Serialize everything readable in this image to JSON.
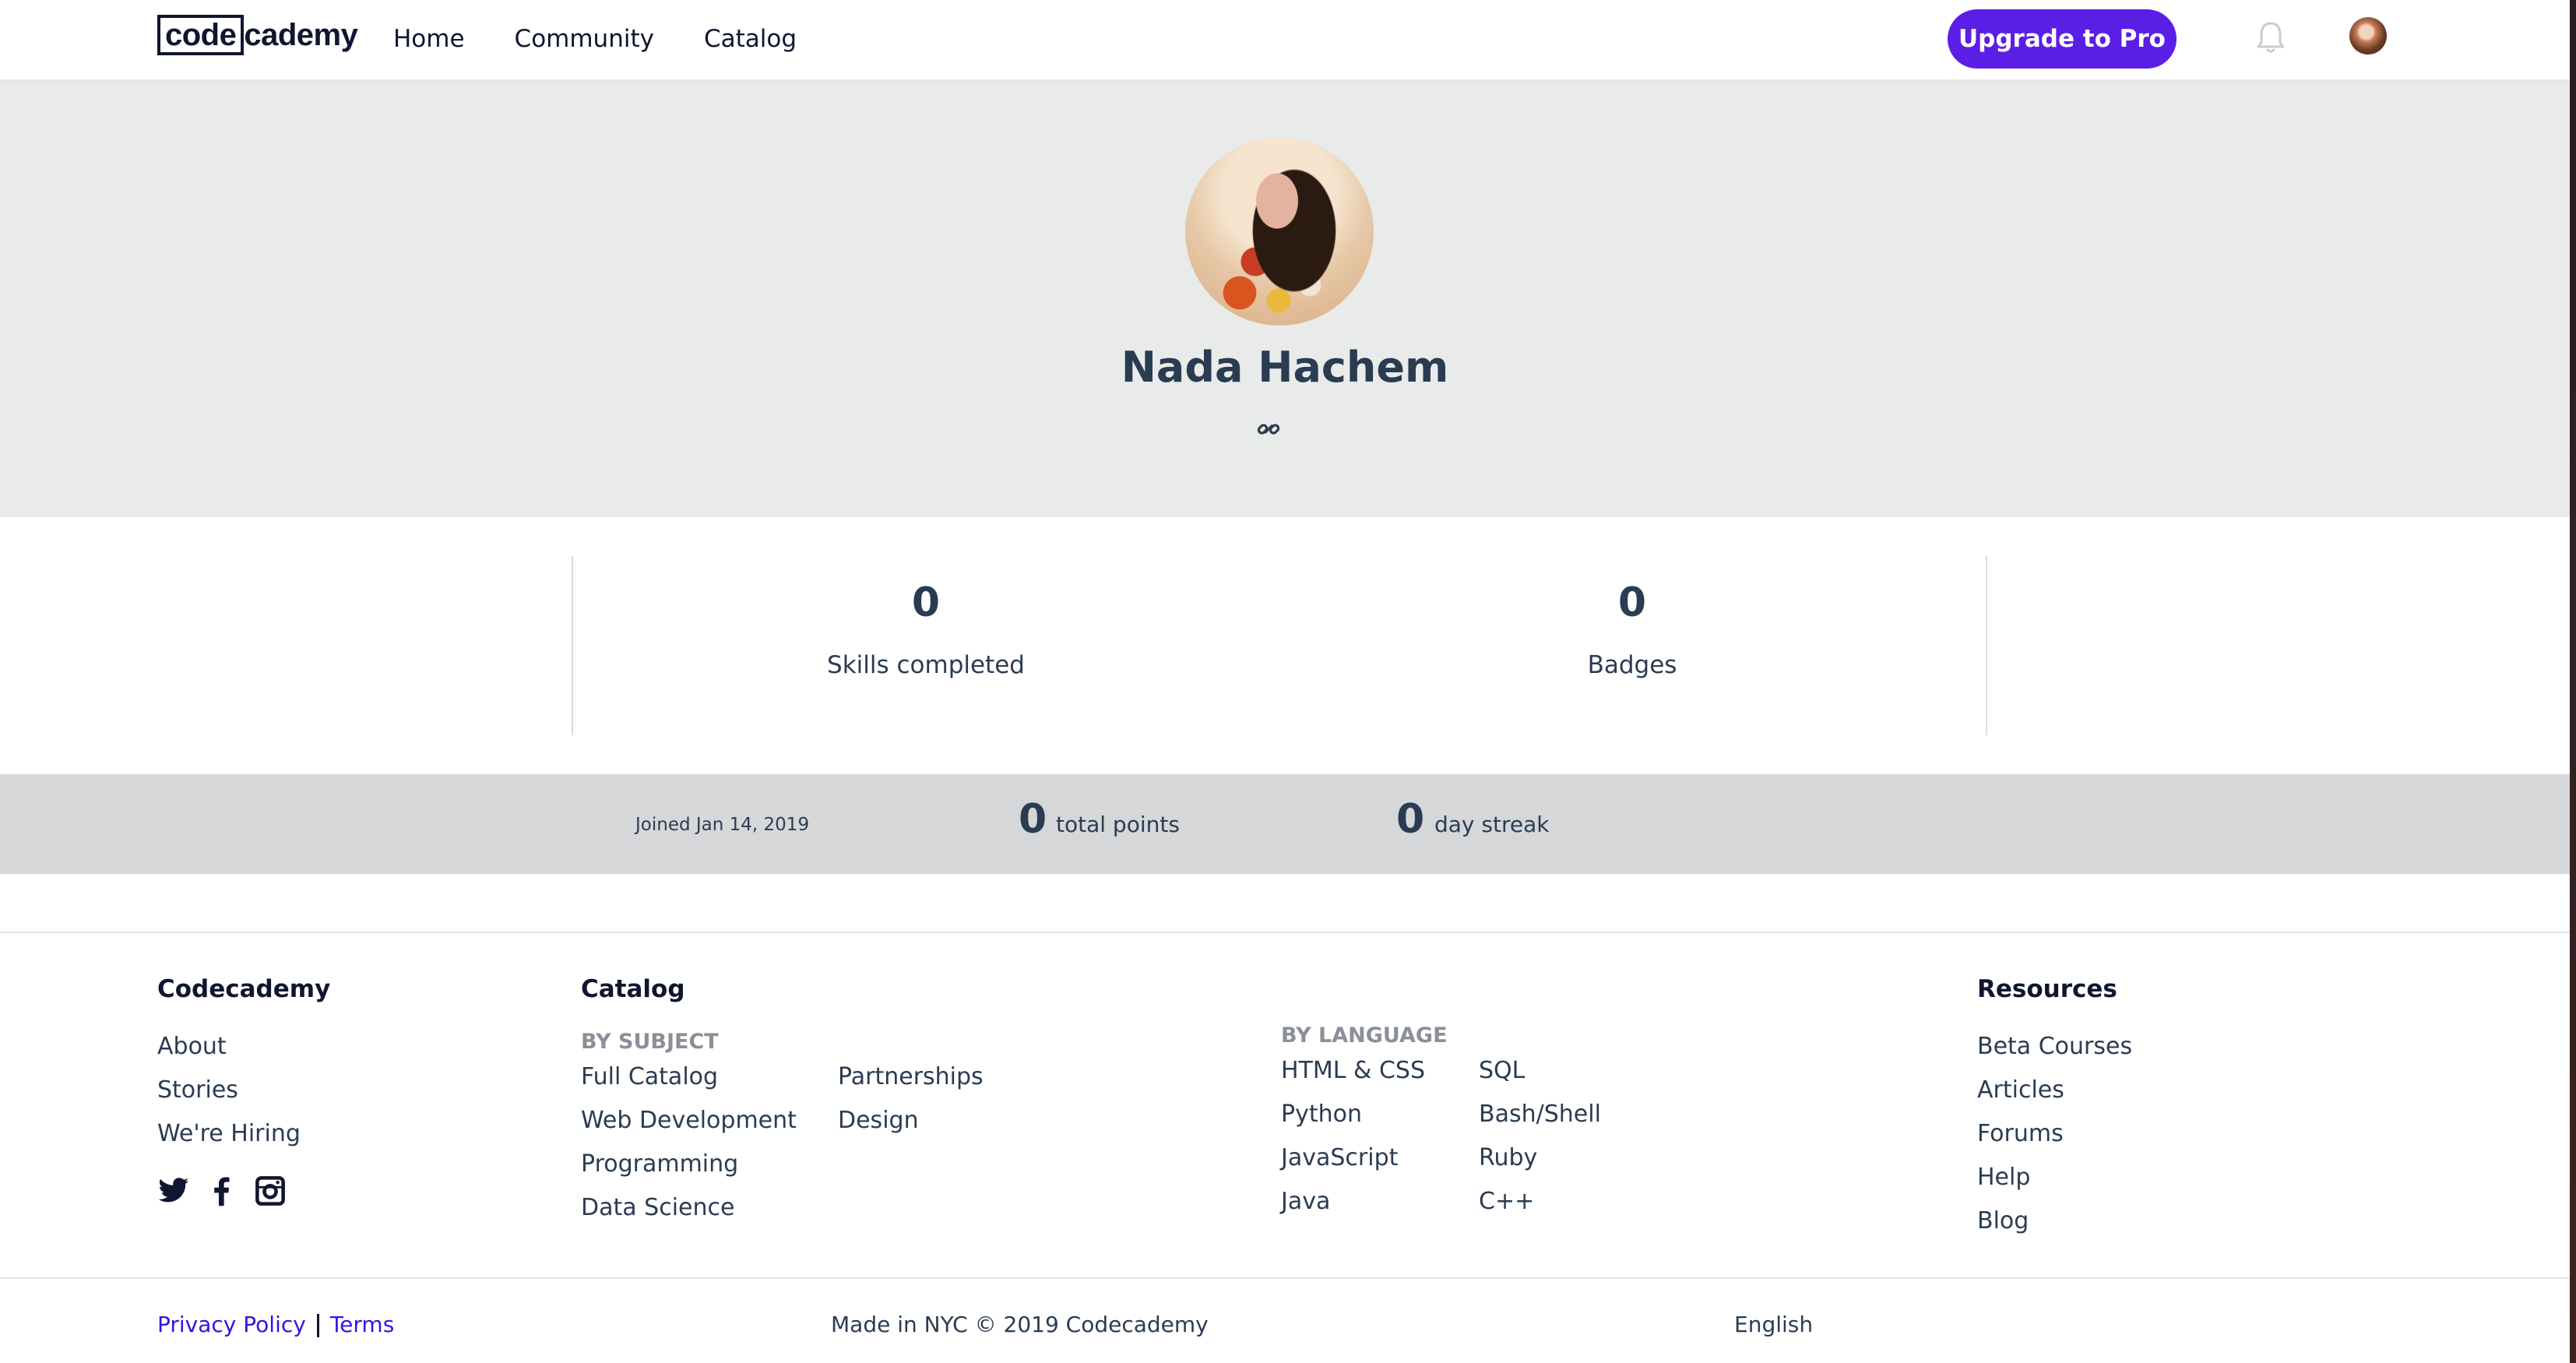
{
  "header": {
    "logo": {
      "boxed": "code",
      "rest": "cademy"
    },
    "nav": [
      "Home",
      "Community",
      "Catalog"
    ],
    "upgrade_label": "Upgrade to Pro"
  },
  "profile": {
    "name": "Nada Hachem"
  },
  "stats": [
    {
      "value": "0",
      "label": "Skills completed"
    },
    {
      "value": "0",
      "label": "Badges"
    }
  ],
  "info": {
    "joined": "Joined Jan 14, 2019",
    "points_value": "0",
    "points_label": "total points",
    "streak_value": "0",
    "streak_label": "day streak"
  },
  "footer": {
    "codecademy": {
      "heading": "Codecademy",
      "links": [
        "About",
        "Stories",
        "We're Hiring"
      ]
    },
    "catalog": {
      "heading": "Catalog",
      "by_subject_label": "BY SUBJECT",
      "subject_col1": [
        "Full Catalog",
        "Web Development",
        "Programming",
        "Data Science"
      ],
      "subject_col2": [
        "Partnerships",
        "Design"
      ],
      "by_language_label": "BY LANGUAGE",
      "language_col1": [
        "HTML & CSS",
        "Python",
        "JavaScript",
        "Java"
      ],
      "language_col2": [
        "SQL",
        "Bash/Shell",
        "Ruby",
        "C++"
      ]
    },
    "resources": {
      "heading": "Resources",
      "links": [
        "Beta Courses",
        "Articles",
        "Forums",
        "Help",
        "Blog"
      ]
    },
    "social_icons": [
      "twitter-icon",
      "facebook-icon",
      "instagram-icon"
    ],
    "bottom": {
      "privacy": "Privacy Policy",
      "terms": "Terms",
      "made_in": "Made in NYC © 2019 Codecademy",
      "language": "English"
    }
  },
  "colors": {
    "brand_purple": "#5b1ee6",
    "link_blue": "#3a10e5",
    "hero_bg": "#e9ebea",
    "info_bg": "#d5d7d9"
  }
}
